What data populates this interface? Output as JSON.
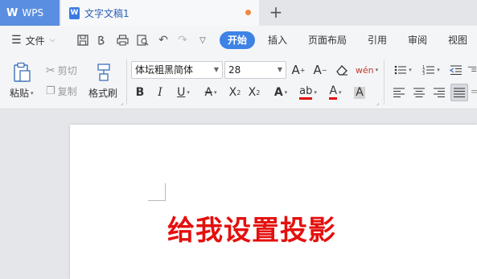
{
  "titlebar": {
    "app_label": "WPS",
    "doc_tab": "文字文稿1"
  },
  "menubar": {
    "file_label": "文件",
    "tabs": [
      "开始",
      "插入",
      "页面布局",
      "引用",
      "审阅",
      "视图"
    ],
    "active_tab": "开始"
  },
  "ribbon": {
    "paste": "粘贴",
    "cut": "剪切",
    "copy": "复制",
    "format_painter": "格式刷",
    "font_name": "体坛粗黑简体",
    "font_size": "28"
  },
  "document": {
    "text": "给我设置投影",
    "text_color": "#e4100d"
  },
  "colors": {
    "accent": "#3d83e6",
    "wps_tab": "#5a8ee0",
    "modified_dot": "#f0873d"
  }
}
